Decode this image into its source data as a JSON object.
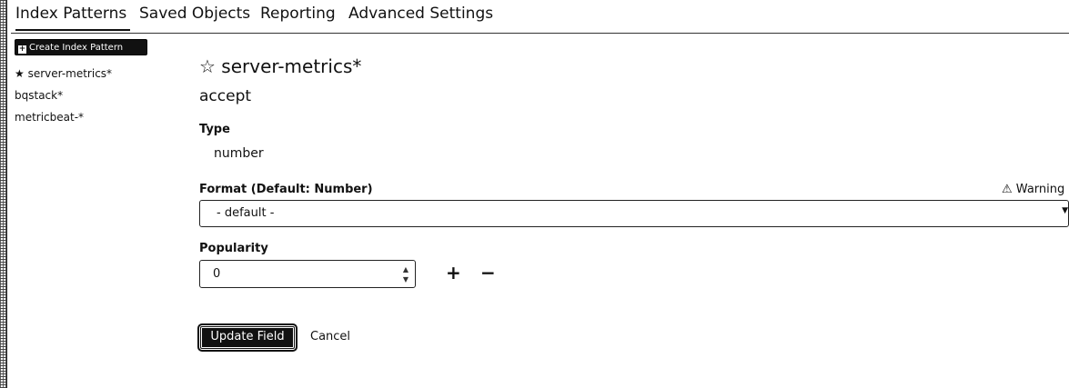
{
  "nav": {
    "tabs": [
      "Index Patterns",
      "Saved Objects",
      "Reporting",
      "Advanced Settings"
    ],
    "active": "Index Patterns"
  },
  "sidebar": {
    "create_label": "Create Index Pattern",
    "items": [
      {
        "label": "server-metrics*",
        "default": true
      },
      {
        "label": "bqstack*"
      },
      {
        "label": "metricbeat-*"
      }
    ]
  },
  "main": {
    "title": "server-metrics*",
    "field_name": "accept",
    "type_label": "Type",
    "type_value": "number",
    "format_label": "Format (Default: Number)",
    "warning": "Warning",
    "format_value": "- default -",
    "popularity_label": "Popularity",
    "popularity_value": "0",
    "plus": "+",
    "minus": "−",
    "update_label": "Update Field",
    "cancel_label": "Cancel"
  },
  "icons": {
    "star": "star-icon",
    "warning": "warning-icon",
    "plus": "plus-icon",
    "caret": "caret-down-icon"
  }
}
